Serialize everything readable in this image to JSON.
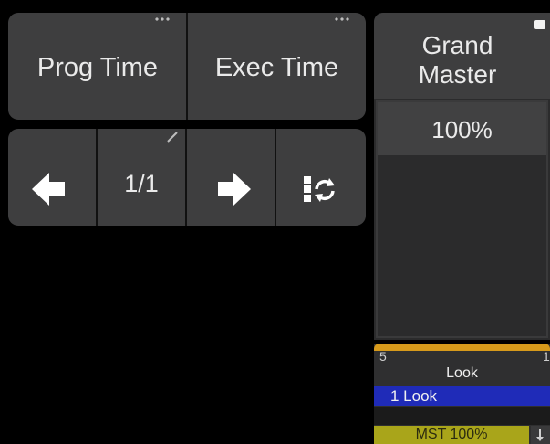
{
  "top_buttons": {
    "prog_time": "Prog Time",
    "exec_time": "Exec Time"
  },
  "nav": {
    "page": "1/1",
    "icons": [
      "arrow-left-icon",
      "arrow-right-icon",
      "sync-icon"
    ]
  },
  "grand_master": {
    "title_line1": "Grand",
    "title_line2": "Master",
    "value": "100%"
  },
  "executor": {
    "number": "5",
    "right_index": "1",
    "name": "Look",
    "cue": "1 Look",
    "master": "MST 100%"
  },
  "colors": {
    "button_bg": "#3e3e3f",
    "executor_bar": "#d79a1b",
    "cue_bg": "#1f2bb8",
    "master_bg": "#a9a51a"
  }
}
